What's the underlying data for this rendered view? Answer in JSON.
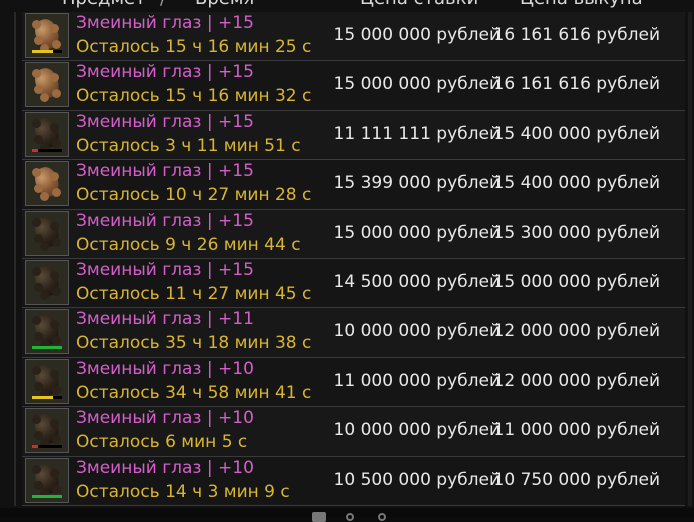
{
  "header": {
    "item": "Предмет",
    "divider": "/",
    "time": "Время",
    "bid": "Цена ставки",
    "buyout": "Цена выкупа"
  },
  "rows": [
    {
      "name": "Змеиный глаз | +15",
      "time": "Осталось 15 ч 16 мин 25 с",
      "bid": "15 000 000 рублей",
      "buyout": "16 161 616 рублей",
      "gem": "brown",
      "durability_color": "#e6c61e",
      "durability": 0.7
    },
    {
      "name": "Змеиный глаз | +15",
      "time": "Осталось 15 ч 16 мин 32 с",
      "bid": "15 000 000 рублей",
      "buyout": "16 161 616 рублей",
      "gem": "brown",
      "durability_color": "",
      "durability": 0
    },
    {
      "name": "Змеиный глаз | +15",
      "time": "Осталось 3 ч 11 мин 51 с",
      "bid": "11 111 111 рублей",
      "buyout": "15 400 000 рублей",
      "gem": "dark",
      "durability_color": "#d52a2a",
      "durability": 0.2
    },
    {
      "name": "Змеиный глаз | +15",
      "time": "Осталось 10 ч 27 мин 28 с",
      "bid": "15 399 000 рублей",
      "buyout": "15 400 000 рублей",
      "gem": "brown",
      "durability_color": "",
      "durability": 0
    },
    {
      "name": "Змеиный глаз | +15",
      "time": "Осталось 9 ч 26 мин 44 с",
      "bid": "15 000 000 рублей",
      "buyout": "15 300 000 рублей",
      "gem": "dark",
      "durability_color": "",
      "durability": 0
    },
    {
      "name": "Змеиный глаз | +15",
      "time": "Осталось 11 ч 27 мин 45 с",
      "bid": "14 500 000 рублей",
      "buyout": "15 000 000 рублей",
      "gem": "dark",
      "durability_color": "",
      "durability": 0
    },
    {
      "name": "Змеиный глаз | +11",
      "time": "Осталось 35 ч 18 мин 38 с",
      "bid": "10 000 000 рублей",
      "buyout": "12 000 000 рублей",
      "gem": "dark",
      "durability_color": "#21b43a",
      "durability": 1.0
    },
    {
      "name": "Змеиный глаз | +10",
      "time": "Осталось 34 ч 58 мин 41 с",
      "bid": "11 000 000 рублей",
      "buyout": "12 000 000 рублей",
      "gem": "dark",
      "durability_color": "#e6c61e",
      "durability": 0.7
    },
    {
      "name": "Змеиный глаз | +10",
      "time": "Осталось 6 мин 5 с",
      "bid": "10 000 000 рублей",
      "buyout": "11 000 000 рублей",
      "gem": "dark",
      "durability_color": "#d52a2a",
      "durability": 0.2
    },
    {
      "name": "Змеиный глаз | +10",
      "time": "Осталось 14 ч 3 мин 9 с",
      "bid": "10 500 000 рублей",
      "buyout": "10 750 000 рублей",
      "gem": "dark",
      "durability_color": "#21b43a",
      "durability": 1.0
    }
  ]
}
